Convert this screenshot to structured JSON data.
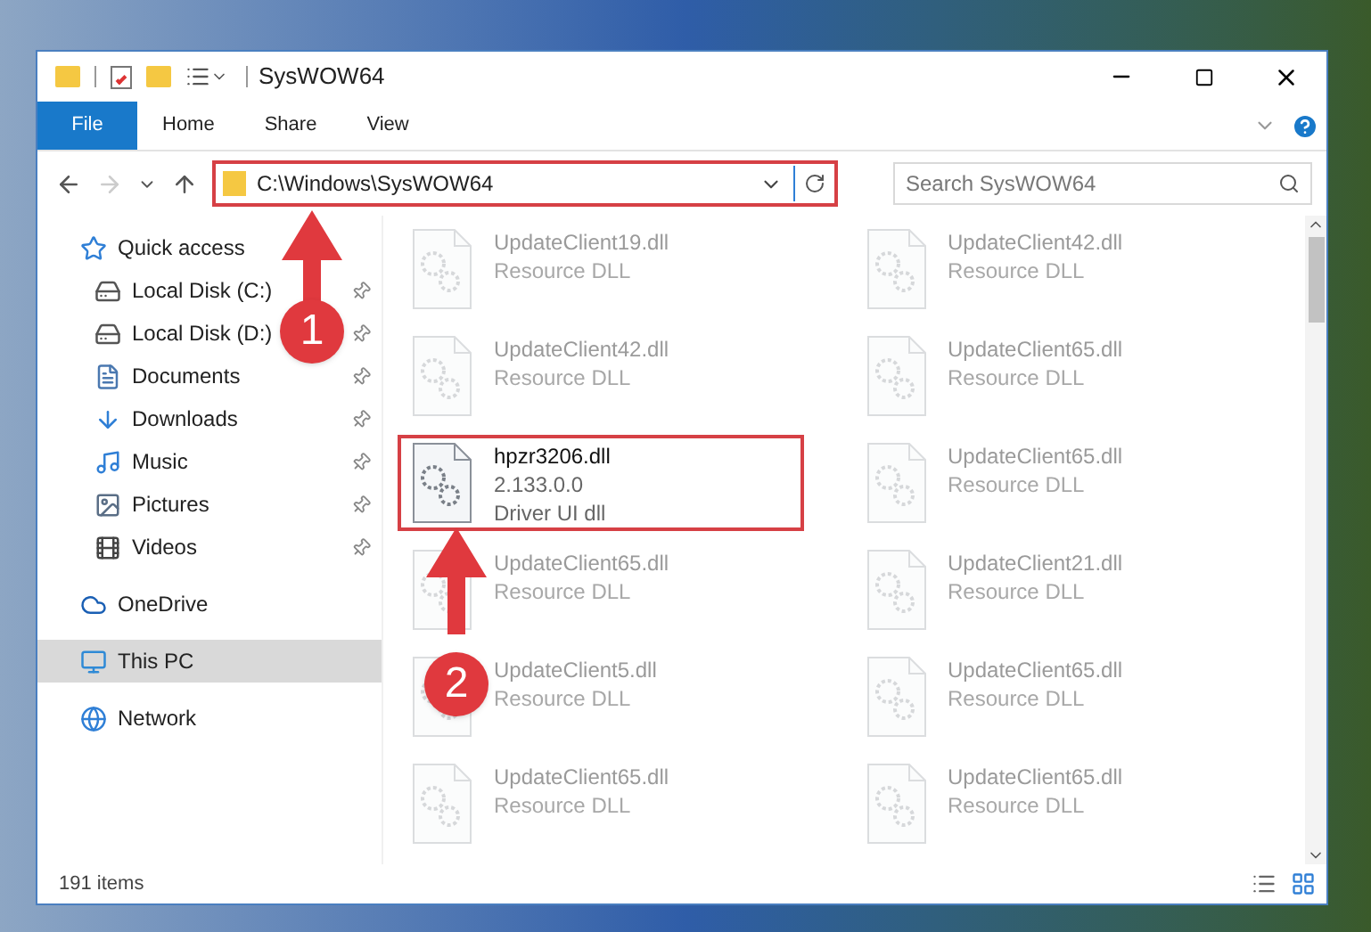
{
  "window": {
    "title": "SysWOW64"
  },
  "ribbon_tabs": [
    {
      "label": "File",
      "kind": "file"
    },
    {
      "label": "Home",
      "kind": "tab"
    },
    {
      "label": "Share",
      "kind": "tab"
    },
    {
      "label": "View",
      "kind": "tab"
    }
  ],
  "address_bar": {
    "path": "C:\\Windows\\SysWOW64",
    "highlighted": true
  },
  "search": {
    "placeholder": "Search SysWOW64"
  },
  "navigation": [
    {
      "label": "Quick access",
      "selected": false,
      "children": [
        {
          "label": "Local Disk (C:)",
          "pinned": true
        },
        {
          "label": "Local Disk (D:)",
          "pinned": true
        },
        {
          "label": "Documents",
          "pinned": true
        },
        {
          "label": "Downloads",
          "pinned": true
        },
        {
          "label": "Music",
          "pinned": true
        },
        {
          "label": "Pictures",
          "pinned": true
        },
        {
          "label": "Videos",
          "pinned": true
        }
      ]
    },
    {
      "label": "OneDrive",
      "selected": false
    },
    {
      "label": "This PC",
      "selected": true
    },
    {
      "label": "Network",
      "selected": false
    }
  ],
  "files": [
    {
      "name": "UpdateClient19.dll",
      "details": [
        "Resource DLL"
      ],
      "faded": true,
      "highlighted": false
    },
    {
      "name": "UpdateClient42.dll",
      "details": [
        "Resource DLL"
      ],
      "faded": true,
      "highlighted": false
    },
    {
      "name": "UpdateClient42.dll",
      "details": [
        "Resource DLL"
      ],
      "faded": true,
      "highlighted": false
    },
    {
      "name": "UpdateClient65.dll",
      "details": [
        "Resource DLL"
      ],
      "faded": true,
      "highlighted": false
    },
    {
      "name": "hpzr3206.dll",
      "details": [
        "2.133.0.0",
        "Driver UI dll"
      ],
      "faded": false,
      "highlighted": true
    },
    {
      "name": "UpdateClient65.dll",
      "details": [
        "Resource DLL"
      ],
      "faded": true,
      "highlighted": false
    },
    {
      "name": "UpdateClient65.dll",
      "details": [
        "Resource DLL"
      ],
      "faded": true,
      "highlighted": false
    },
    {
      "name": "UpdateClient21.dll",
      "details": [
        "Resource DLL"
      ],
      "faded": true,
      "highlighted": false
    },
    {
      "name": "UpdateClient5.dll",
      "details": [
        "Resource DLL"
      ],
      "faded": true,
      "highlighted": false
    },
    {
      "name": "UpdateClient65.dll",
      "details": [
        "Resource DLL"
      ],
      "faded": true,
      "highlighted": false
    },
    {
      "name": "UpdateClient65.dll",
      "details": [
        "Resource DLL"
      ],
      "faded": true,
      "highlighted": false
    },
    {
      "name": "UpdateClient65.dll",
      "details": [
        "Resource DLL"
      ],
      "faded": true,
      "highlighted": false
    }
  ],
  "status_bar": {
    "item_count": "191 items"
  },
  "annotations": [
    {
      "number": "1"
    },
    {
      "number": "2"
    }
  ]
}
